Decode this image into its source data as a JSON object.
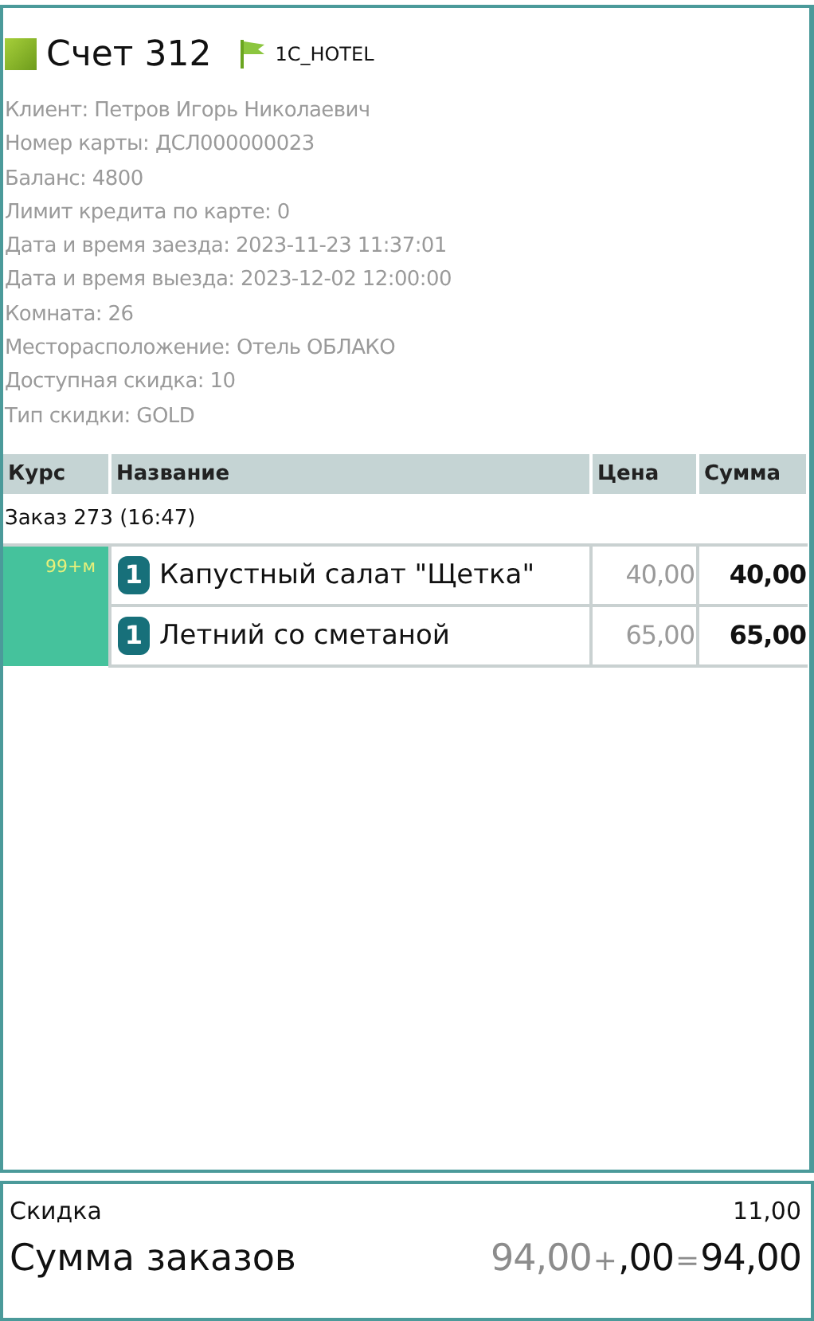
{
  "header": {
    "title": "Счет 312",
    "tag": "1C_HOTEL"
  },
  "info": [
    "Клиент: Петров Игорь Николаевич",
    "Номер карты: ДСЛ000000023",
    "Баланс: 4800",
    "Лимит кредита по карте: 0",
    "Дата и время заезда: 2023-11-23 11:37:01",
    "Дата и время выезда: 2023-12-02 12:00:00",
    "Комната: 26",
    "Месторасположение: Отель ОБЛАКО",
    "Доступная скидка: 10",
    "Тип скидки: GOLD"
  ],
  "table": {
    "columns": [
      "Курс",
      "Название",
      "Цена",
      "Сумма"
    ],
    "group": "Заказ 273 (16:47)",
    "course": "99+м",
    "rows": [
      {
        "qty": "1",
        "name": "Капустный салат \"Щетка\"",
        "price": "40,00",
        "sum": "40,00"
      },
      {
        "qty": "1",
        "name": "Летний со сметаной",
        "price": "65,00",
        "sum": "65,00"
      }
    ]
  },
  "footer": {
    "discount_label": "Скидка",
    "discount_value": "11,00",
    "total_label": "Сумма заказов",
    "orders": "94,00",
    "plus": "+",
    "extra": ",00",
    "equals": "=",
    "total": "94,00"
  }
}
